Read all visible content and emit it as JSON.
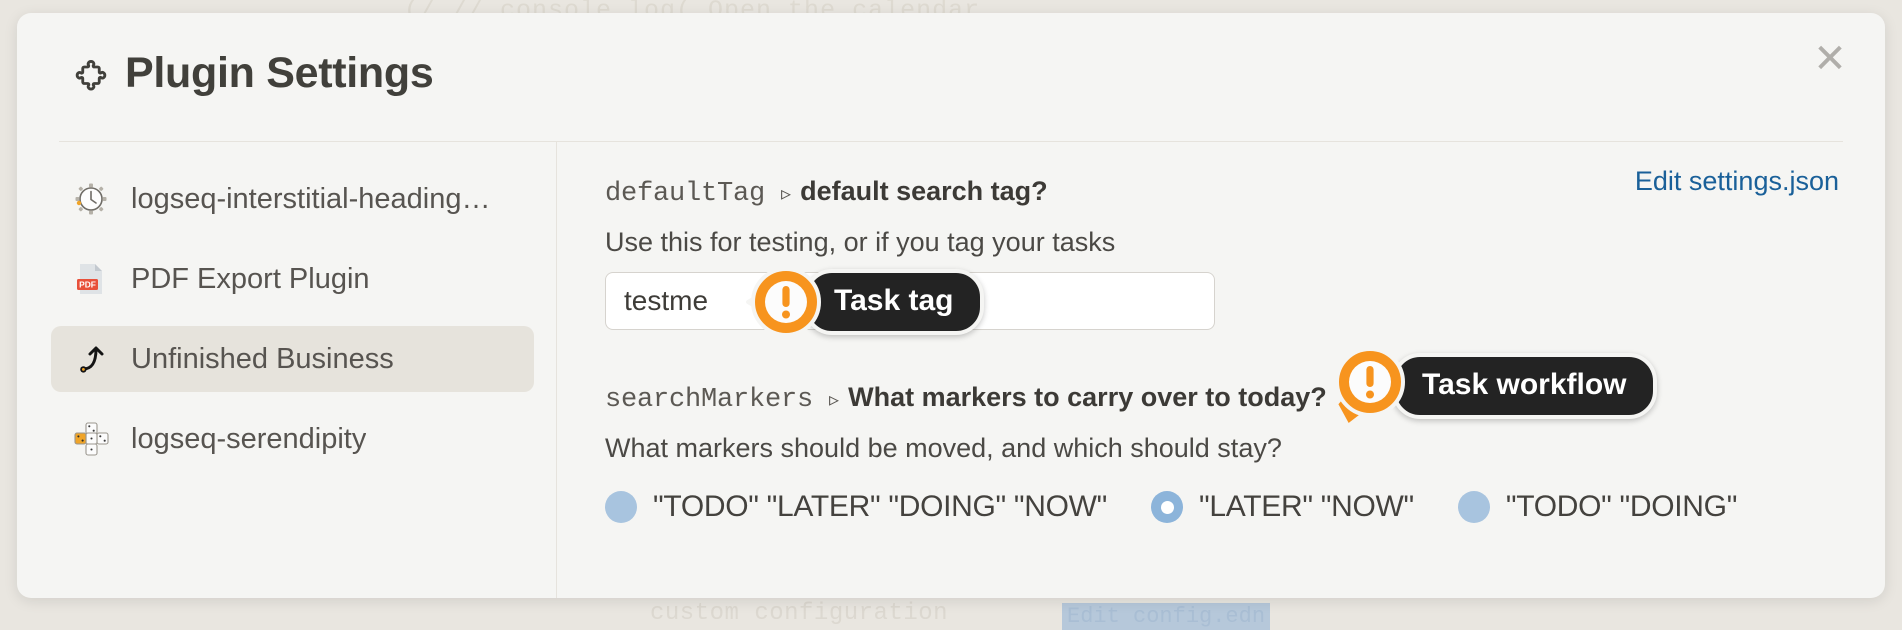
{
  "background": {
    "top_line": "(/  //    console.log( Open the calendar",
    "bottom_line": "custom configuration",
    "bottom_chip": "Edit config.edn"
  },
  "header": {
    "title": "Plugin Settings",
    "icon": "puzzle-piece-icon",
    "close_icon": "close-icon",
    "close_label": "✕"
  },
  "sidebar": {
    "items": [
      {
        "label": "logseq-interstitial-heading…",
        "icon": "clock-plugin-icon",
        "active": false
      },
      {
        "label": "PDF Export Plugin",
        "icon": "pdf-file-icon",
        "active": false
      },
      {
        "label": "Unfinished Business",
        "icon": "curved-arrow-icon",
        "active": true
      },
      {
        "label": "logseq-serendipity",
        "icon": "dice-icon",
        "active": false
      }
    ]
  },
  "main": {
    "edit_link": "Edit settings.json",
    "settings": [
      {
        "key": "defaultTag",
        "caret": "▹",
        "description": "default search tag?",
        "sub_description": "Use this for testing, or if you tag your tasks",
        "input_value": "testme",
        "input_placeholder": ""
      },
      {
        "key": "searchMarkers",
        "caret": "▹",
        "description": "What markers to carry over to today?",
        "sub_description": "What markers should be moved, and which should stay?",
        "options": [
          {
            "label": "\"TODO\" \"LATER\" \"DOING\" \"NOW\"",
            "selected": false
          },
          {
            "label": "\"LATER\" \"NOW\"",
            "selected": true
          },
          {
            "label": "\"TODO\" \"DOING\"",
            "selected": false
          }
        ]
      }
    ]
  },
  "callouts": [
    {
      "label": "Task tag",
      "badge": "exclamation-badge-icon",
      "tail": "left"
    },
    {
      "label": "Task workflow",
      "badge": "exclamation-badge-icon",
      "tail": "bottom-left"
    }
  ],
  "colors": {
    "accent_orange": "#F7941E",
    "link_blue": "#1A6099",
    "tooltip_bg": "#232323",
    "card_bg": "#F5F5F3",
    "page_bg": "#E9E6E0",
    "active_item_bg": "#E6E3DC",
    "radio_blue": "#A8C4DF"
  }
}
